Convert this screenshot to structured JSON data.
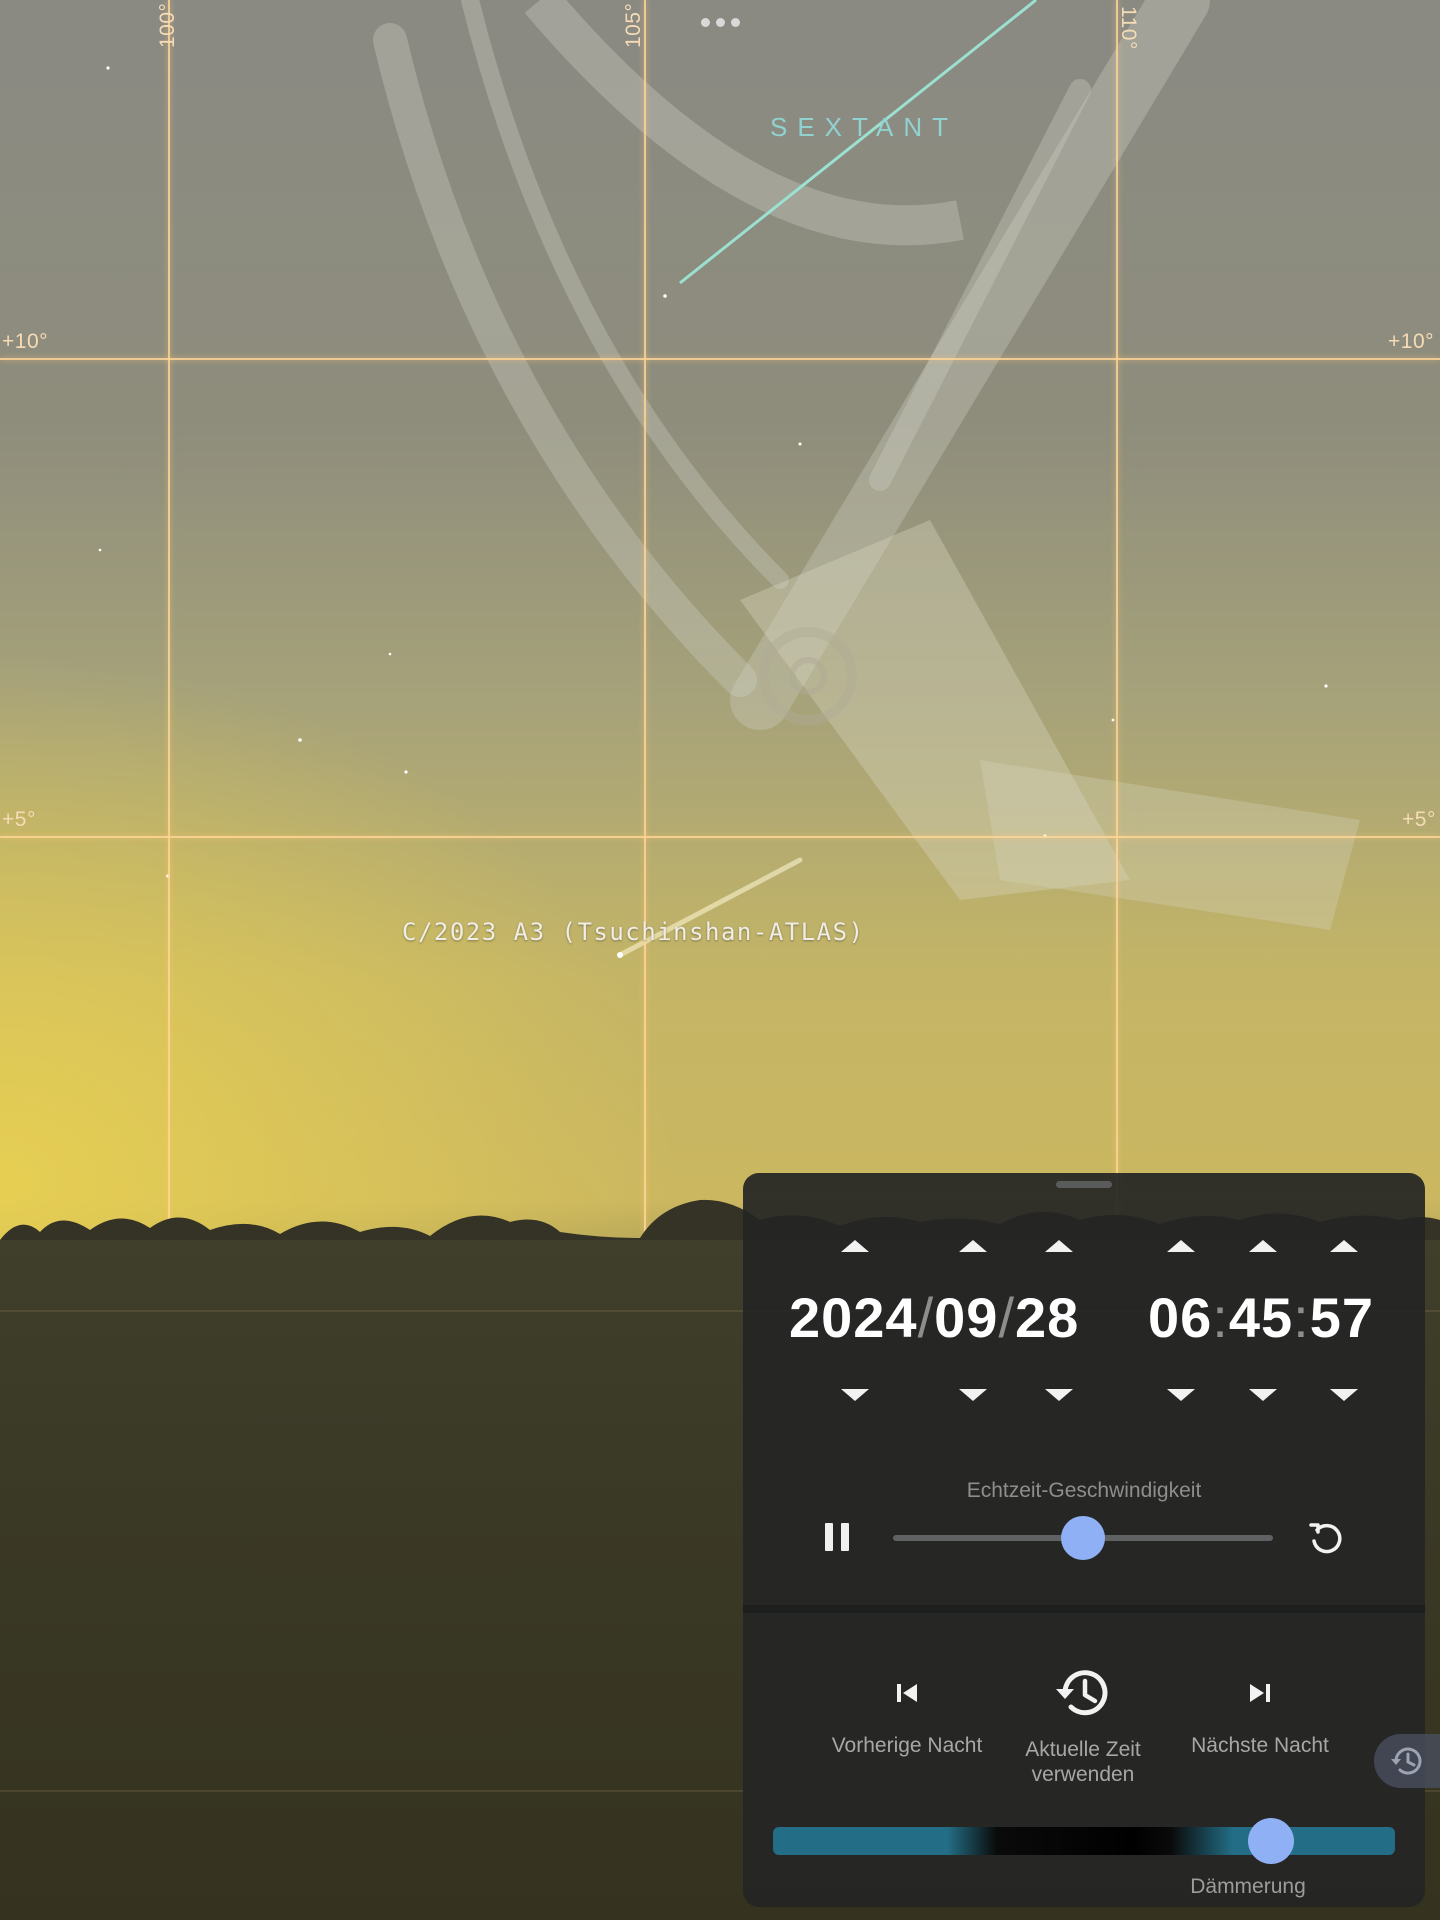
{
  "sky": {
    "ra_labels": [
      "100°",
      "105°",
      "110°"
    ],
    "dec_labels": [
      "+10°",
      "+10°",
      "+5°",
      "+5°"
    ],
    "constellation": "SEXTANT",
    "comet": "C/2023 A3 (Tsuchinshan-ATLAS)"
  },
  "time_panel": {
    "date": {
      "year": "2024",
      "month": "09",
      "day": "28",
      "separator": "/"
    },
    "time": {
      "hour": "06",
      "minute": "45",
      "second": "57",
      "separator": ":"
    },
    "speed_label": "Echtzeit-Geschwindigkeit",
    "speed_slider_fraction": 0.5,
    "nav": {
      "previous_night": "Vorherige Nacht",
      "current_time_line1": "Aktuelle Zeit",
      "current_time_line2": "verwenden",
      "next_night": "Nächste Nacht"
    },
    "twilight_label": "Dämmerung",
    "twilight_slider_fraction": 0.8,
    "colors": {
      "accent": "#8fb0f5",
      "twilight": "#236e86",
      "panel": "#252625"
    }
  },
  "icons": [
    "menu-dots-icon",
    "pause-icon",
    "reset-icon",
    "skip-previous-icon",
    "history-icon",
    "skip-next-icon"
  ]
}
